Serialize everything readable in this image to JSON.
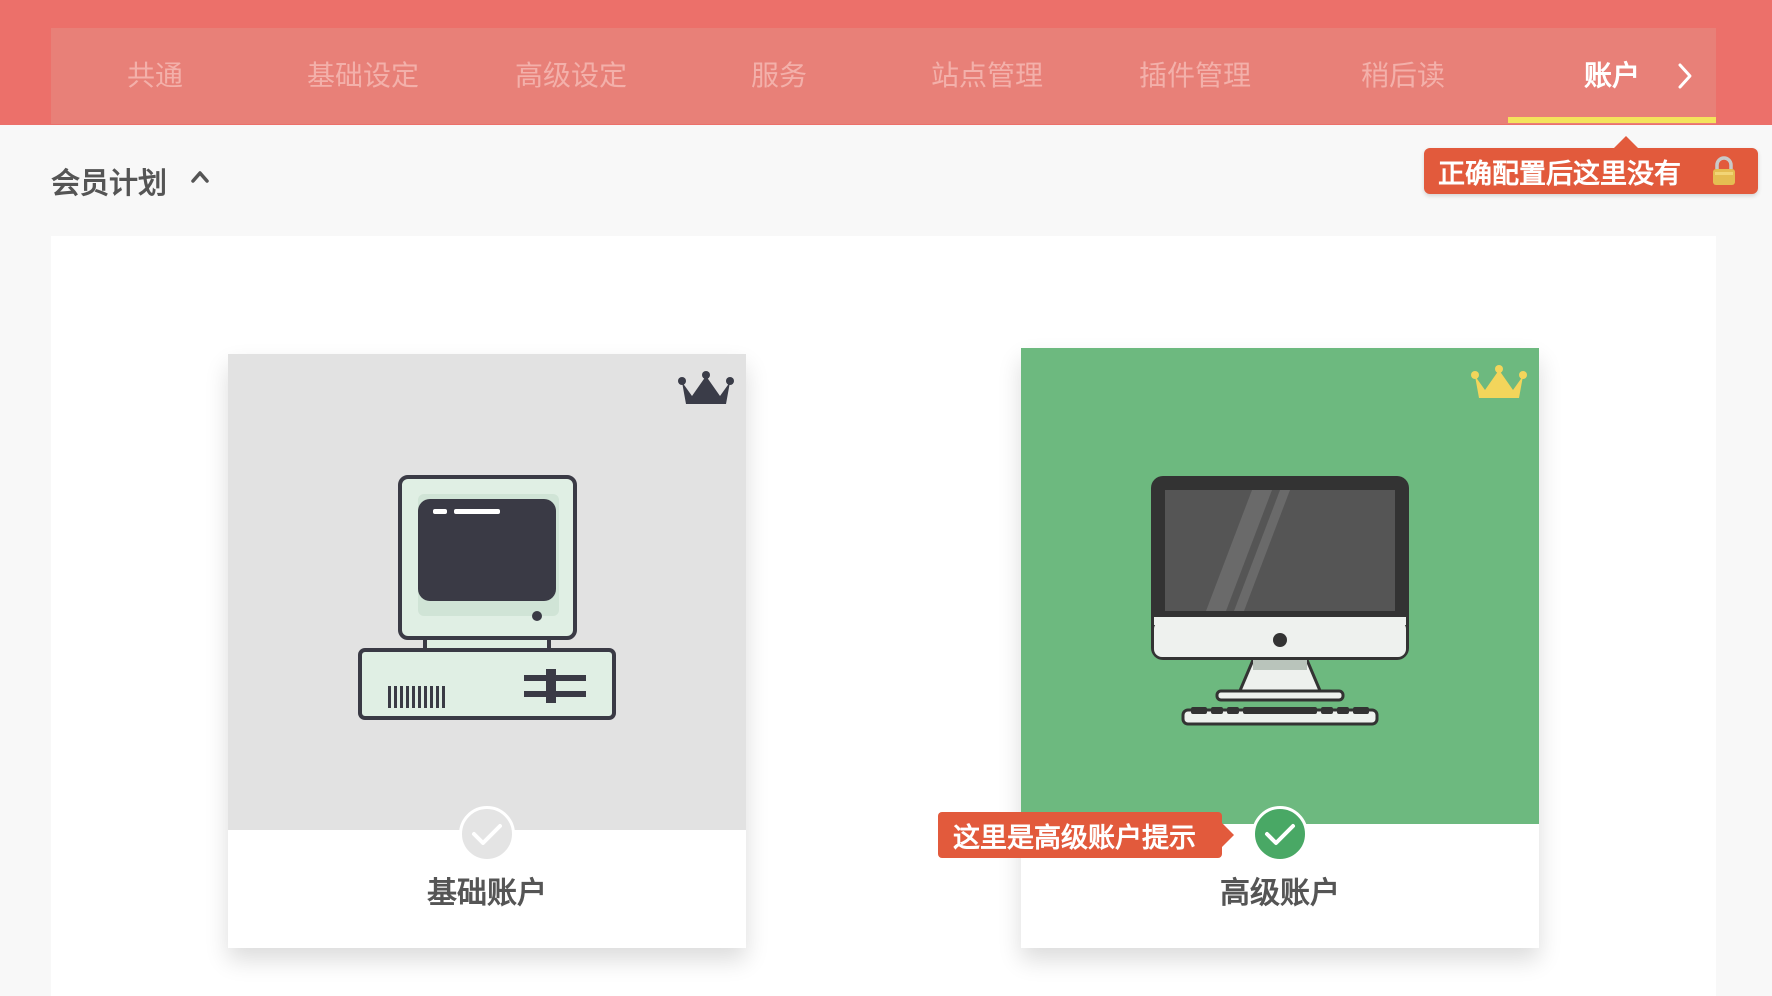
{
  "nav": {
    "tabs": [
      {
        "label": "共通"
      },
      {
        "label": "基础设定"
      },
      {
        "label": "高级设定"
      },
      {
        "label": "服务"
      },
      {
        "label": "站点管理"
      },
      {
        "label": "插件管理"
      },
      {
        "label": "稍后读"
      },
      {
        "label": "账户"
      }
    ],
    "active_tab": "账户",
    "next_icon": "chevron-right-icon"
  },
  "hints": {
    "top": "正确配置后这里没有",
    "pro": "这里是高级账户提示"
  },
  "section": {
    "title": "会员计划",
    "toggle_icon": "chevron-up-icon"
  },
  "plans": [
    {
      "label": "基础账户",
      "selected": false,
      "crown_color": "#3a3c48",
      "hero_color": "#e2e2e2"
    },
    {
      "label": "高级账户",
      "selected": true,
      "crown_color": "#f3d55b",
      "hero_color": "#6db97f"
    }
  ],
  "colors": {
    "topbar": "#ec706a",
    "accent": "#e25a3c",
    "underline": "#f4e35c"
  }
}
